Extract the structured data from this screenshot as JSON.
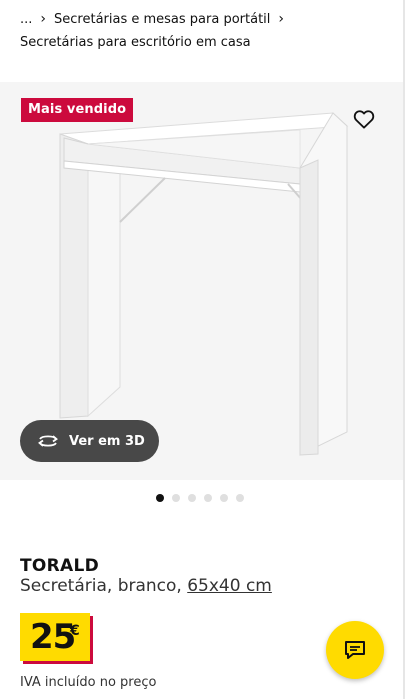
{
  "breadcrumb": {
    "ellipsis": "...",
    "category": "Secretárias e mesas para portátil",
    "current": "Secretárias para escritório em casa"
  },
  "product_image": {
    "badge": "Mais vendido",
    "view_3d_label": "Ver em 3D",
    "carousel_total": 6,
    "carousel_active": 1
  },
  "product": {
    "name": "TORALD",
    "description": "Secretária, branco,",
    "dimensions": "65x40 cm",
    "price": "25",
    "currency": "€",
    "vat_note": "IVA incluído no preço"
  },
  "icons": {
    "favorite": "heart-icon",
    "rotate": "rotate-3d-icon",
    "chat": "chat-icon"
  },
  "colors": {
    "badge": "#cc0a3d",
    "price_bg": "#ffdb00",
    "chat_bg": "#ffdb00",
    "view3d_bg": "#484848"
  }
}
